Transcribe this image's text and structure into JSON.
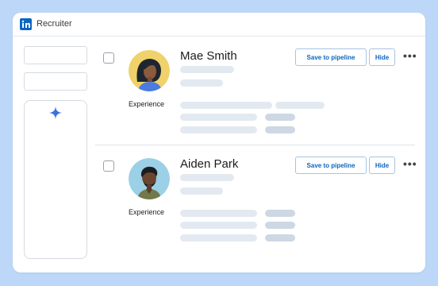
{
  "app": {
    "title": "Recruiter",
    "brand_color": "#0a66c2"
  },
  "candidates": [
    {
      "name": "Mae Smith",
      "section_label": "Experience",
      "save_label": "Save to pipeline",
      "hide_label": "Hide",
      "more_label": "•••",
      "avatar_bg": "#efd26a"
    },
    {
      "name": "Aiden Park",
      "section_label": "Experience",
      "save_label": "Save to pipeline",
      "hide_label": "Hide",
      "more_label": "•••",
      "avatar_bg": "#9bd0e6"
    }
  ],
  "icons": {
    "logo": "linkedin-logo-icon",
    "assistant": "sparkle-icon",
    "more": "more-horizontal-icon"
  }
}
